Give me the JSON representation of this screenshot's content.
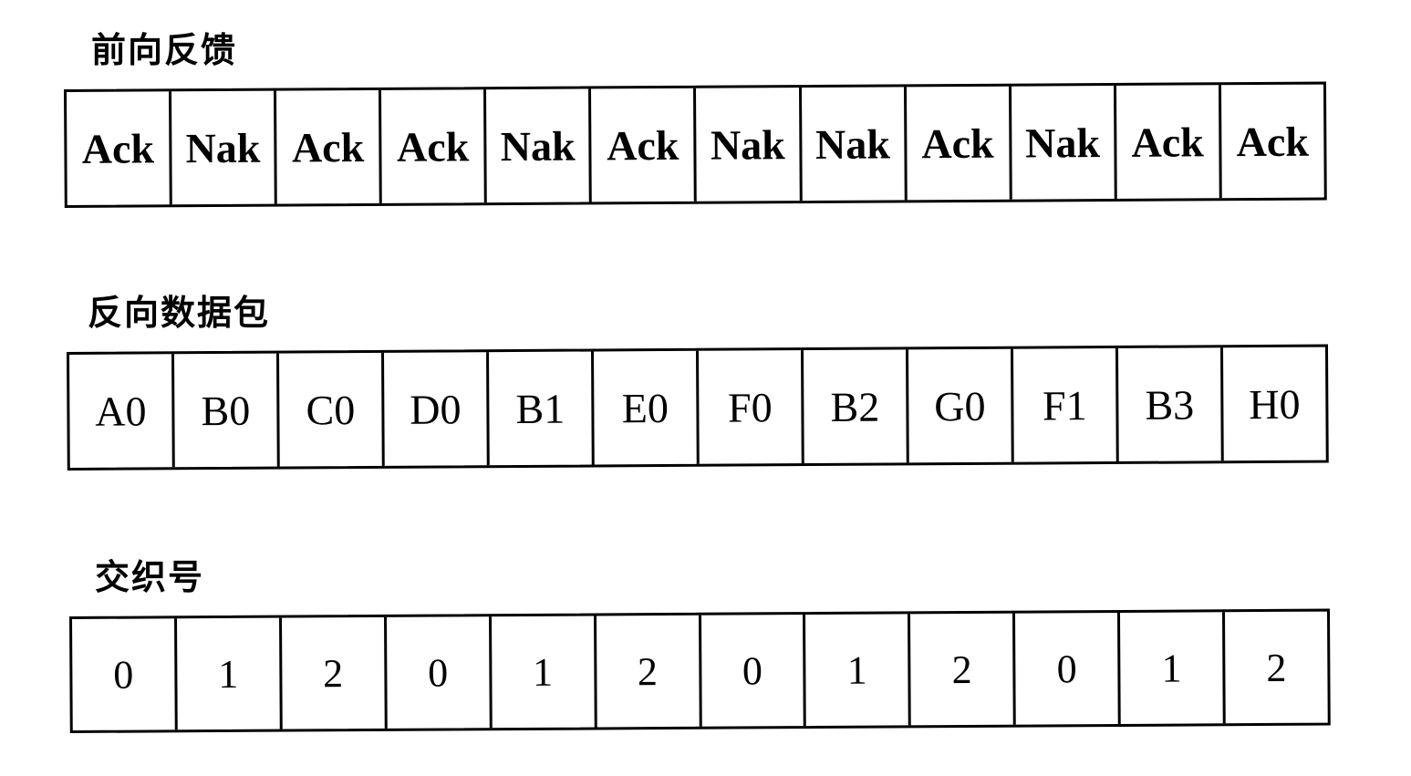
{
  "sections": {
    "forward_feedback": {
      "label": "前向反馈",
      "cells": [
        "Ack",
        "Nak",
        "Ack",
        "Ack",
        "Nak",
        "Ack",
        "Nak",
        "Nak",
        "Ack",
        "Nak",
        "Ack",
        "Ack"
      ]
    },
    "reverse_packets": {
      "label": "反向数据包",
      "cells": [
        "A0",
        "B0",
        "C0",
        "D0",
        "B1",
        "E0",
        "F0",
        "B2",
        "G0",
        "F1",
        "B3",
        "H0"
      ]
    },
    "interleave_number": {
      "label": "交织号",
      "cells": [
        "0",
        "1",
        "2",
        "0",
        "1",
        "2",
        "0",
        "1",
        "2",
        "0",
        "1",
        "2"
      ]
    }
  }
}
